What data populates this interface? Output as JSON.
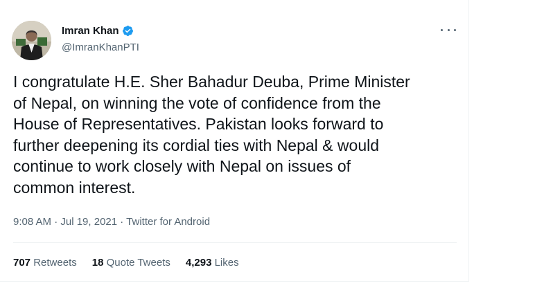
{
  "tweet": {
    "author": {
      "display_name": "Imran Khan",
      "handle": "@ImranKhanPTI",
      "verified": true,
      "avatar_icon": "profile-photo"
    },
    "text": "I congratulate H.E. Sher Bahadur Deuba, Prime Minister\nof Nepal, on winning the vote of confidence from the\nHouse of Representatives. Pakistan looks forward to\nfurther deepening its cordial ties with Nepal & would\ncontinue to work closely with Nepal on issues of\ncommon interest.",
    "timestamp": "9:08 AM · Jul 19, 2021 · Twitter for Android",
    "stats": {
      "retweets_count": "707",
      "retweets_label": "Retweets",
      "quotes_count": "18",
      "quotes_label": "Quote Tweets",
      "likes_count": "4,293",
      "likes_label": "Likes"
    }
  },
  "colors": {
    "verified_blue": "#1d9bf0",
    "text_primary": "#0f1419",
    "text_secondary": "#536471",
    "divider": "#eff3f4"
  },
  "icons": {
    "more": "more-horizontal-icon",
    "verified": "verified-badge-icon"
  }
}
